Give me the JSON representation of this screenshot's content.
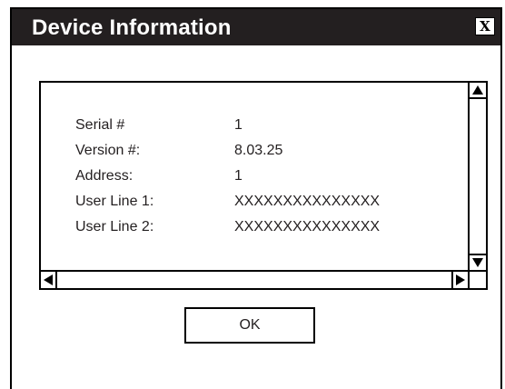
{
  "window": {
    "title": "Device Information",
    "close_glyph": "X"
  },
  "info": {
    "rows": [
      {
        "label": "Serial #",
        "value": "1"
      },
      {
        "label": "Version #:",
        "value": "8.03.25"
      },
      {
        "label": "Address:",
        "value": "1"
      },
      {
        "label": "User Line 1:",
        "value": "XXXXXXXXXXXXXXX"
      },
      {
        "label": "User Line 2:",
        "value": "XXXXXXXXXXXXXXX"
      }
    ]
  },
  "buttons": {
    "ok_label": "OK"
  },
  "icons": {
    "close": "close-icon",
    "scroll_up": "scroll-up-arrow-icon",
    "scroll_down": "scroll-down-arrow-icon",
    "scroll_left": "scroll-left-arrow-icon",
    "scroll_right": "scroll-right-arrow-icon"
  },
  "colors": {
    "titlebar": "#231f20",
    "title_text": "#ffffff",
    "border": "#000000",
    "text": "#231f20"
  }
}
